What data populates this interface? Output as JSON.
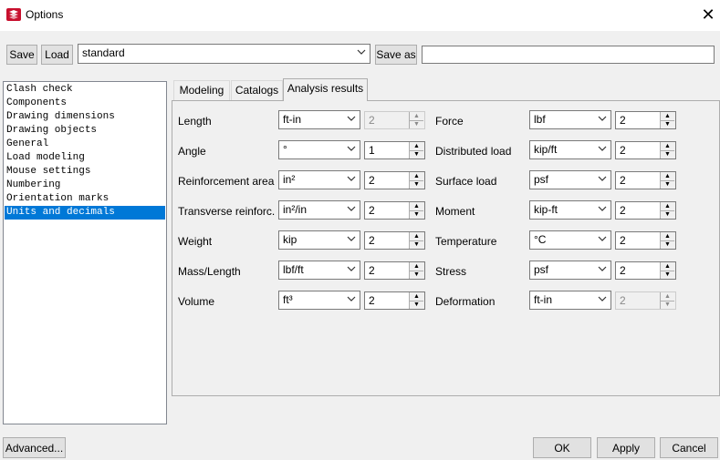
{
  "window": {
    "title": "Options"
  },
  "toolbar": {
    "save_label": "Save",
    "load_label": "Load",
    "preset_value": "standard",
    "save_as_label": "Save as",
    "save_as_name": ""
  },
  "sidebar": {
    "items": [
      "Clash check",
      "Components",
      "Drawing dimensions",
      "Drawing objects",
      "General",
      "Load modeling",
      "Mouse settings",
      "Numbering",
      "Orientation marks",
      "Units and decimals"
    ],
    "selected_index": 9
  },
  "tabs": [
    "Modeling",
    "Catalogs",
    "Analysis results"
  ],
  "active_tab_index": 2,
  "left_rows": [
    {
      "label": "Length",
      "unit": "ft-in",
      "decimals": "2",
      "decimals_disabled": true
    },
    {
      "label": "Angle",
      "unit": "°",
      "decimals": "1",
      "decimals_disabled": false
    },
    {
      "label": "Reinforcement area",
      "unit": "in²",
      "decimals": "2",
      "decimals_disabled": false
    },
    {
      "label": "Transverse reinforc.",
      "unit": "in²/in",
      "decimals": "2",
      "decimals_disabled": false
    },
    {
      "label": "Weight",
      "unit": "kip",
      "decimals": "2",
      "decimals_disabled": false
    },
    {
      "label": "Mass/Length",
      "unit": "lbf/ft",
      "decimals": "2",
      "decimals_disabled": false
    },
    {
      "label": "Volume",
      "unit": "ft³",
      "decimals": "2",
      "decimals_disabled": false
    }
  ],
  "right_rows": [
    {
      "label": "Force",
      "unit": "lbf",
      "decimals": "2",
      "decimals_disabled": false
    },
    {
      "label": "Distributed load",
      "unit": "kip/ft",
      "decimals": "2",
      "decimals_disabled": false
    },
    {
      "label": "Surface load",
      "unit": "psf",
      "decimals": "2",
      "decimals_disabled": false
    },
    {
      "label": "Moment",
      "unit": "kip-ft",
      "decimals": "2",
      "decimals_disabled": false
    },
    {
      "label": "Temperature",
      "unit": "°C",
      "decimals": "2",
      "decimals_disabled": false
    },
    {
      "label": "Stress",
      "unit": "psf",
      "decimals": "2",
      "decimals_disabled": false
    },
    {
      "label": "Deformation",
      "unit": "ft-in",
      "decimals": "2",
      "decimals_disabled": true
    }
  ],
  "footer": {
    "advanced_label": "Advanced...",
    "ok_label": "OK",
    "apply_label": "Apply",
    "cancel_label": "Cancel"
  },
  "colors": {
    "selection": "#0078d7",
    "window_bg": "#f0f0f0",
    "brand_icon": "#c8102e"
  }
}
